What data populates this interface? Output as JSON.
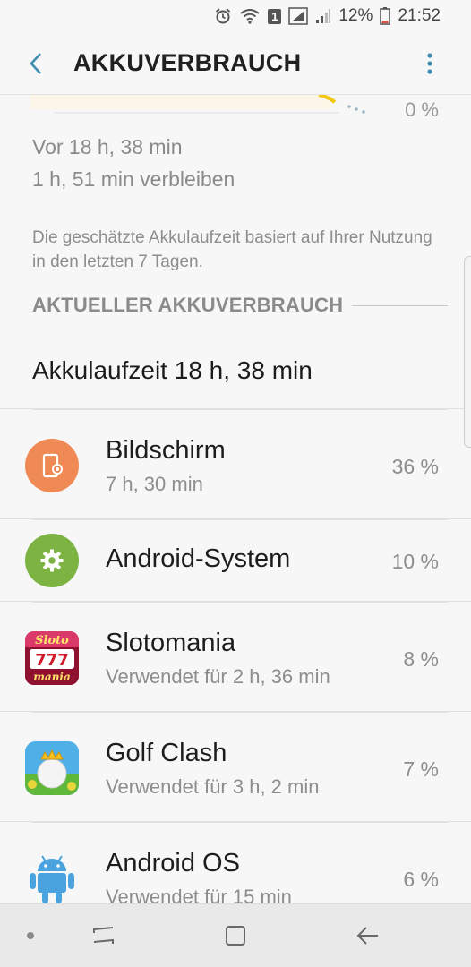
{
  "status_bar": {
    "notification_badge": "1",
    "battery_percent": "12%",
    "time": "21:52"
  },
  "app_bar": {
    "title": "AKKUVERBRAUCH"
  },
  "graph": {
    "end_percent": "0 %"
  },
  "summary": {
    "since": "Vor 18 h, 38 min",
    "remaining": "1 h, 51 min verbleiben",
    "note": "Die geschätzte Akkulaufzeit basiert auf Ihrer Nutzung in den letzten 7 Tagen."
  },
  "section": {
    "header": "AKTUELLER AKKUVERBRAUCH",
    "total": "Akkulaufzeit 18 h, 38 min"
  },
  "apps": [
    {
      "name": "Bildschirm",
      "detail": "7 h, 30 min",
      "percent": "36 %",
      "icon": "screen-icon",
      "color": "#ef8a54"
    },
    {
      "name": "Android-System",
      "detail": "",
      "percent": "10 %",
      "icon": "gear-icon",
      "color": "#7cb342"
    },
    {
      "name": "Slotomania",
      "detail": "Verwendet für 2 h, 36 min",
      "percent": "8 %",
      "icon": "slotomania-icon"
    },
    {
      "name": "Golf Clash",
      "detail": "Verwendet für 3 h, 2 min",
      "percent": "7 %",
      "icon": "golf-clash-icon"
    },
    {
      "name": "Android OS",
      "detail": "Verwendet für 15 min",
      "percent": "6 %",
      "icon": "android-icon",
      "color": "#4aa3df"
    }
  ],
  "colors": {
    "accent": "#3f8fb0",
    "graph_line": "#f2c811"
  }
}
